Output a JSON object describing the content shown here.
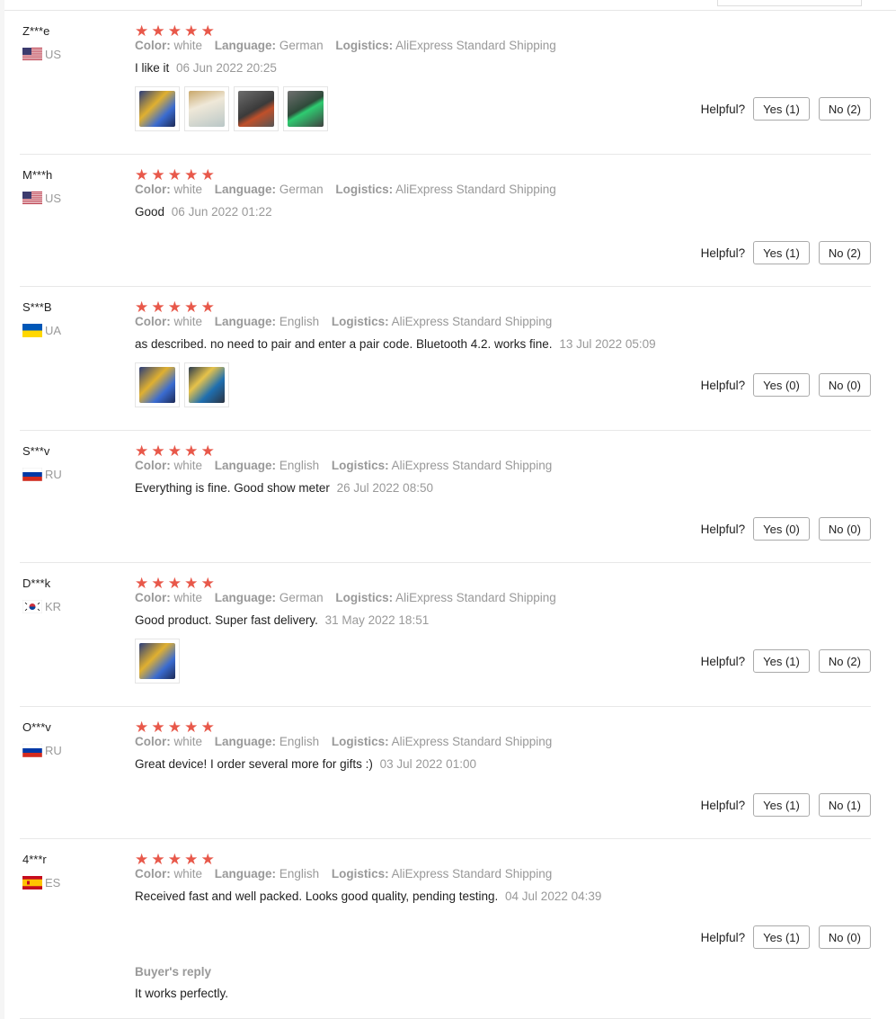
{
  "colors": {
    "star": "#e8584a",
    "meta_gray": "#999999",
    "text": "#222222"
  },
  "labels": {
    "color": "Color:",
    "language": "Language:",
    "logistics": "Logistics:",
    "helpful": "Helpful?",
    "buyers_reply": "Buyer's reply"
  },
  "reviews": [
    {
      "user": "Z***e",
      "country": "US",
      "flag": "us-flag-icon",
      "stars": 5,
      "color": "white",
      "language": "German",
      "logistics": "AliExpress Standard Shipping",
      "text": "I like it",
      "date": "06 Jun 2022 20:25",
      "yes": "Yes (1)",
      "no": "No (2)",
      "photos": [
        "photo-battery-monitor-package",
        "photo-manual",
        "photo-device-closeup",
        "photo-device-green-display"
      ]
    },
    {
      "user": "M***h",
      "country": "US",
      "flag": "us-flag-icon",
      "stars": 5,
      "color": "white",
      "language": "German",
      "logistics": "AliExpress Standard Shipping",
      "text": "Good",
      "date": "06 Jun 2022 01:22",
      "yes": "Yes (1)",
      "no": "No (2)",
      "photos": []
    },
    {
      "user": "S***B",
      "country": "UA",
      "flag": "ua-flag-icon",
      "stars": 5,
      "color": "white",
      "language": "English",
      "logistics": "AliExpress Standard Shipping",
      "text": "as described. no need to pair and enter a pair code. Bluetooth 4.2. works fine.",
      "date": "13 Jul 2022 05:09",
      "yes": "Yes (0)",
      "no": "No (0)",
      "photos": [
        "photo-battery-monitor-package",
        "photo-battery-monitor-package-back"
      ]
    },
    {
      "user": "S***v",
      "country": "RU",
      "flag": "ru-flag-icon",
      "stars": 5,
      "color": "white",
      "language": "English",
      "logistics": "AliExpress Standard Shipping",
      "text": "Everything is fine. Good show meter",
      "date": "26 Jul 2022 08:50",
      "yes": "Yes (0)",
      "no": "No (0)",
      "photos": []
    },
    {
      "user": "D***k",
      "country": "KR",
      "flag": "kr-flag-icon",
      "stars": 5,
      "color": "white",
      "language": "German",
      "logistics": "AliExpress Standard Shipping",
      "text": "Good product. Super fast delivery.",
      "date": "31 May 2022 18:51",
      "yes": "Yes (1)",
      "no": "No (2)",
      "photos": [
        "photo-battery-monitor-package"
      ]
    },
    {
      "user": "O***v",
      "country": "RU",
      "flag": "ru-flag-icon",
      "stars": 5,
      "color": "white",
      "language": "English",
      "logistics": "AliExpress Standard Shipping",
      "text": "Great device! I order several more for gifts :)",
      "date": "03 Jul 2022 01:00",
      "yes": "Yes (1)",
      "no": "No (1)",
      "photos": []
    },
    {
      "user": "4***r",
      "country": "ES",
      "flag": "es-flag-icon",
      "stars": 5,
      "color": "white",
      "language": "English",
      "logistics": "AliExpress Standard Shipping",
      "text": "Received fast and well packed. Looks good quality, pending testing.",
      "date": "04 Jul 2022 04:39",
      "yes": "Yes (1)",
      "no": "No (0)",
      "photos": [],
      "reply": "It works perfectly."
    }
  ]
}
